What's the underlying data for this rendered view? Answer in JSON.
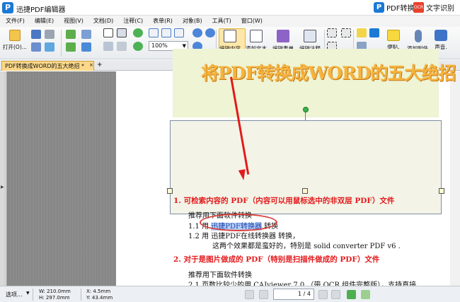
{
  "app": {
    "title": "迅捷PDF编辑器",
    "logo_letter": "P",
    "pdf_convert_label": "PDF转换",
    "ocr_badge": "OCR",
    "ocr_label": "文字识别"
  },
  "menu": [
    "文件(F)",
    "编辑(E)",
    "视图(V)",
    "文档(D)",
    "注释(C)",
    "表单(R)",
    "对象(B)",
    "工具(T)",
    "窗口(W)"
  ],
  "toolbar": {
    "open_label": "打开(O)...",
    "zoom_value": "100%",
    "edit_content_label": "编辑内容",
    "add_text_label": "添加文本",
    "edit_form_label": "编辑表单",
    "edit_annotation_label": "编辑注释",
    "sticky_note_label": "便贴.",
    "attachment_label": "添加附件.",
    "sound_label": "声音."
  },
  "tabs": {
    "active_tab": "PDF转换成WORD的五大绝招 *",
    "close_glyph": "×",
    "add_glyph": "+"
  },
  "document": {
    "banner_title": "将PDF转换成WORD的五大绝招",
    "lines": [
      "1. 可检索内容的 PDF（内容可以用鼠标选中的非双层 PDF）文件",
      "推荐用下面软件转换",
      "1.2 用 迅捷PDF在线转换器   转换，",
      "这两个效果都是蛮好的，特别是 solid converter PDF v6 .",
      "2.  对于是图片做成的 PDF（特别是扫描件做成的 PDF）文件",
      "推荐用下面软件转换",
      "2.1  页数比较少的用 CAJviewer 7.0 （带 OCR 组件完整版），支持直接"
    ],
    "line_1_1_prefix": "1.1 用 ",
    "line_1_1_selected": "迅捷PDF转换器",
    "line_1_1_suffix": " 转换"
  },
  "status": {
    "mode": "选项...",
    "width": "W: 210.0mm",
    "height": "H: 297.0mm",
    "x": "X:     4.5mm",
    "y": "Y:    43.4mm",
    "page": "1 / 4"
  },
  "colors": {
    "accent_blue": "#1b79d6",
    "heading_red": "#e31a1c",
    "banner_orange": "#f6b33e",
    "tab_active": "#fbd88a"
  }
}
